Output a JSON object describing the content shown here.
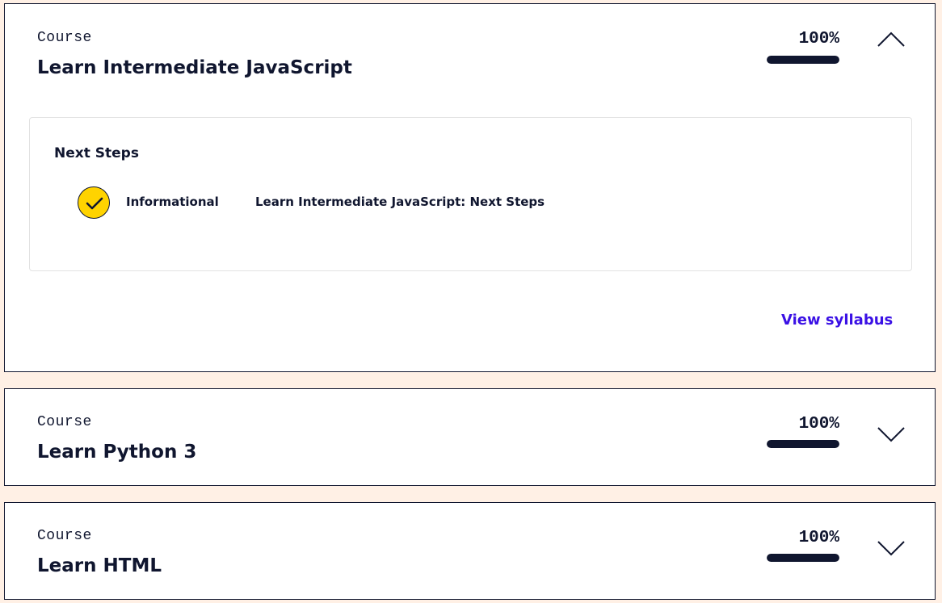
{
  "colors": {
    "page_background": "#fff0e5",
    "text": "#10162f",
    "progress_fill": "#10162f",
    "check_badge": "#ffd300",
    "link": "#3a10e5"
  },
  "courses": [
    {
      "kind": "Course",
      "title": "Learn Intermediate JavaScript",
      "progress_label": "100%",
      "progress_fraction": 1.0,
      "expanded": true,
      "toggle_icon": "chevron-up-icon",
      "section": {
        "heading": "Next Steps",
        "items": [
          {
            "status_icon": "check-circle-icon",
            "type": "Informational",
            "name": "Learn Intermediate JavaScript: Next Steps"
          }
        ]
      },
      "link_label": "View syllabus"
    },
    {
      "kind": "Course",
      "title": "Learn Python 3",
      "progress_label": "100%",
      "progress_fraction": 1.0,
      "expanded": false,
      "toggle_icon": "chevron-down-icon"
    },
    {
      "kind": "Course",
      "title": "Learn HTML",
      "progress_label": "100%",
      "progress_fraction": 1.0,
      "expanded": false,
      "toggle_icon": "chevron-down-icon"
    }
  ]
}
